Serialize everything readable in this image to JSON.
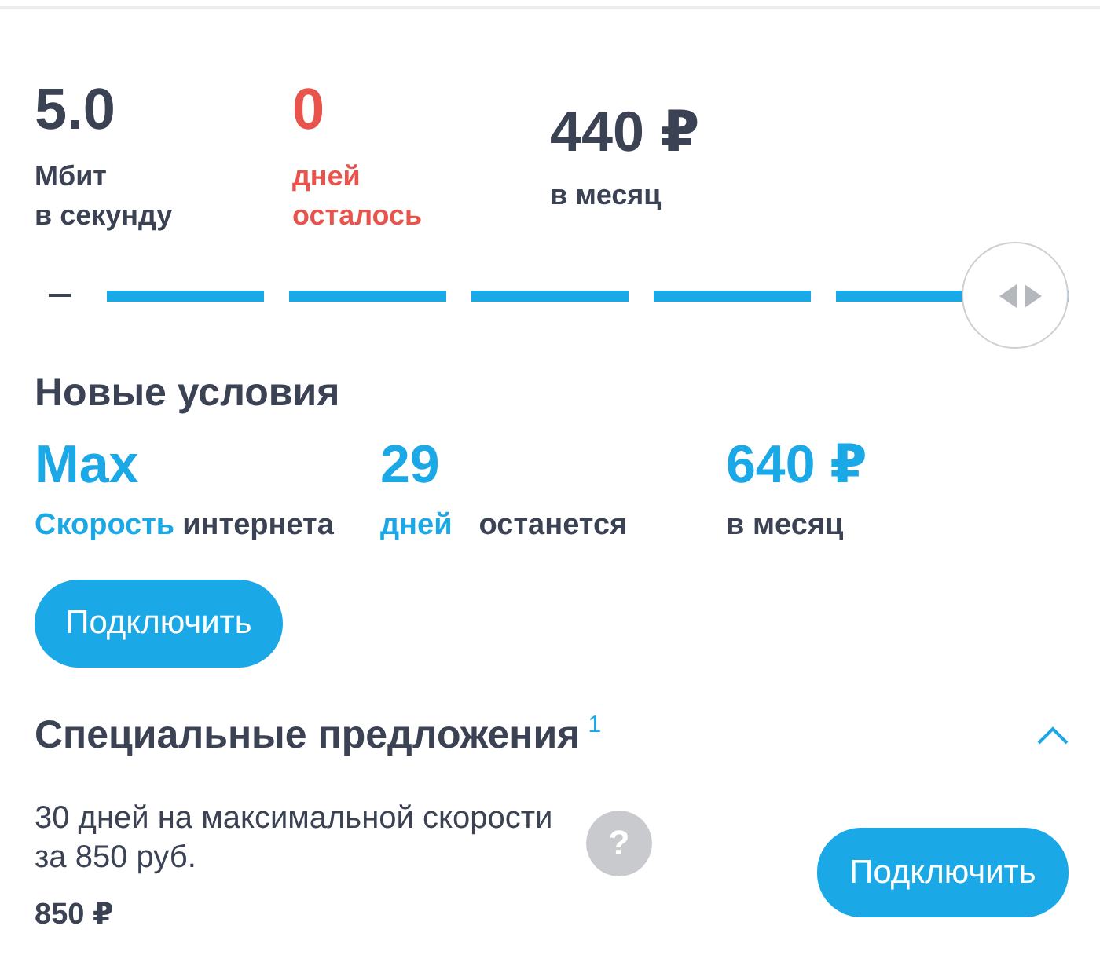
{
  "current": {
    "stats": [
      {
        "kind": "metric",
        "value": "5.0",
        "label": "Мбит\nв секунду",
        "color": "#3b4254"
      },
      {
        "kind": "metric",
        "value": "0",
        "label": "дней\nосталось",
        "color": "#e8534c"
      },
      {
        "kind": "price",
        "value": "440 ₽",
        "label": "в месяц",
        "color": "#3b4254"
      }
    ]
  },
  "slider": {
    "level": 1
  },
  "new_terms": {
    "title": "Новые условия",
    "items": [
      {
        "value": "Max",
        "accent": "Скорость",
        "label": "интернета"
      },
      {
        "value": "29",
        "accent": "дней",
        "label": "останется"
      },
      {
        "value": "640 ₽",
        "label": "в месяц"
      }
    ],
    "button": "Подключить"
  },
  "special_offers": {
    "title": "Специальные предложения$^{1}$",
    "expanded": true,
    "offers": [
      {
        "text": "30 дней на максимальной скорости за 850 руб.",
        "hint": "?",
        "price": "850 ₽",
        "button": "Подключить"
      }
    ]
  }
}
